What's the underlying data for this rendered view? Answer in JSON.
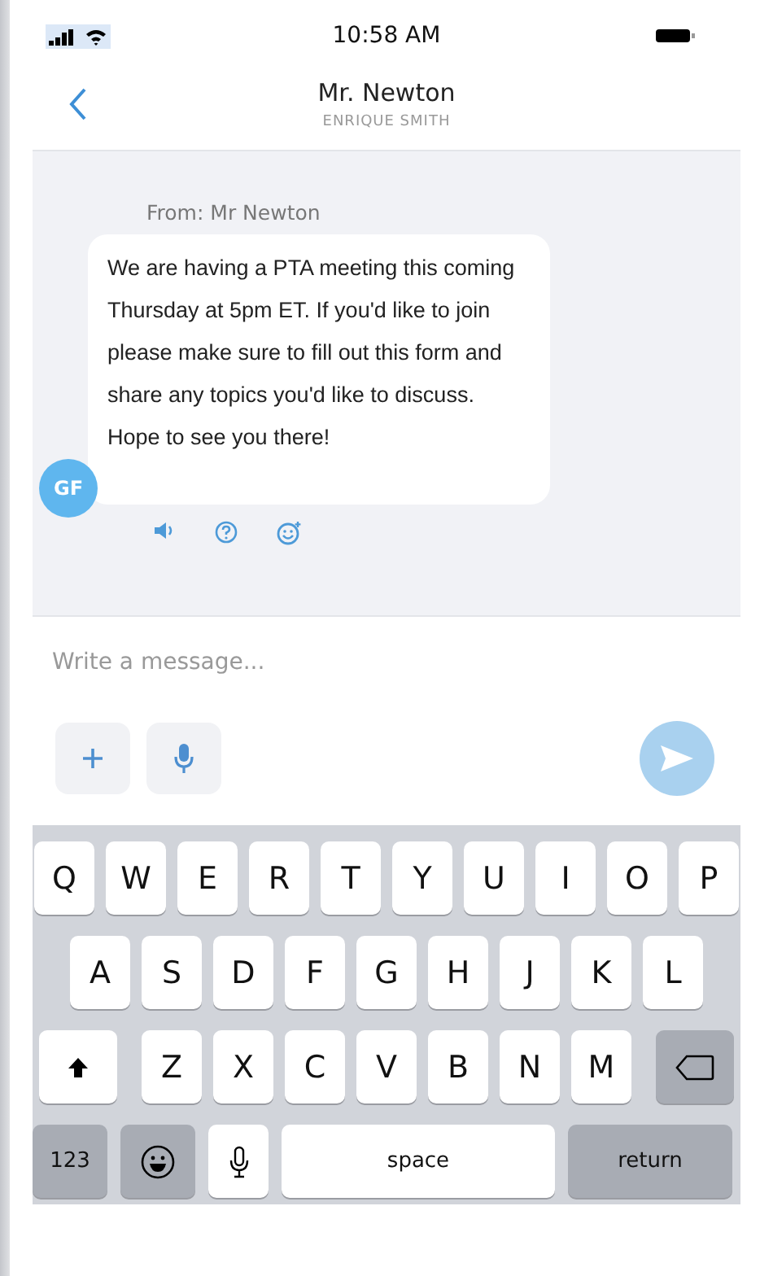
{
  "status_bar": {
    "time": "10:58 AM"
  },
  "header": {
    "title": "Mr. Newton",
    "subtitle": "ENRIQUE SMITH"
  },
  "message": {
    "sender": "From: Mr Newton",
    "avatar": "GF",
    "text": "We are having a PTA meeting this coming Thursday at 5pm ET. If you'd like to join please make sure to fill out this form and share any topics you'd like to discuss. Hope to see you there!"
  },
  "composer": {
    "placeholder": "Write a message..."
  },
  "keyboard": {
    "top_row": [
      {
        "kind": "letter",
        "label": "Q"
      },
      {
        "kind": "letter",
        "label": "W"
      },
      {
        "kind": "letter",
        "label": "E"
      },
      {
        "kind": "letter",
        "label": "R"
      },
      {
        "kind": "letter",
        "label": "T"
      },
      {
        "kind": "letter",
        "label": "Y"
      },
      {
        "kind": "letter",
        "label": "U"
      },
      {
        "kind": "letter",
        "label": "I"
      },
      {
        "kind": "letter",
        "label": "O"
      },
      {
        "kind": "letter",
        "label": "P"
      }
    ],
    "home_row": [
      {
        "kind": "letter",
        "label": "A"
      },
      {
        "kind": "letter",
        "label": "S"
      },
      {
        "kind": "letter",
        "label": "D"
      },
      {
        "kind": "letter",
        "label": "F"
      },
      {
        "kind": "letter",
        "label": "G"
      },
      {
        "kind": "letter",
        "label": "H"
      },
      {
        "kind": "letter",
        "label": "J"
      },
      {
        "kind": "letter",
        "label": "K"
      },
      {
        "kind": "letter",
        "label": "L"
      }
    ],
    "lower_row": [
      {
        "kind": "shift"
      },
      {
        "kind": "letter",
        "label": "Z"
      },
      {
        "kind": "letter",
        "label": "X"
      },
      {
        "kind": "letter",
        "label": "C"
      },
      {
        "kind": "letter",
        "label": "V"
      },
      {
        "kind": "letter",
        "label": "B"
      },
      {
        "kind": "letter",
        "label": "N"
      },
      {
        "kind": "letter",
        "label": "M"
      },
      {
        "kind": "delete"
      }
    ],
    "function_row": [
      {
        "kind": "mode",
        "label": "123"
      },
      {
        "kind": "emoji"
      },
      {
        "kind": "mic"
      },
      {
        "kind": "space",
        "label": "space"
      },
      {
        "kind": "return",
        "label": "return"
      }
    ]
  }
}
